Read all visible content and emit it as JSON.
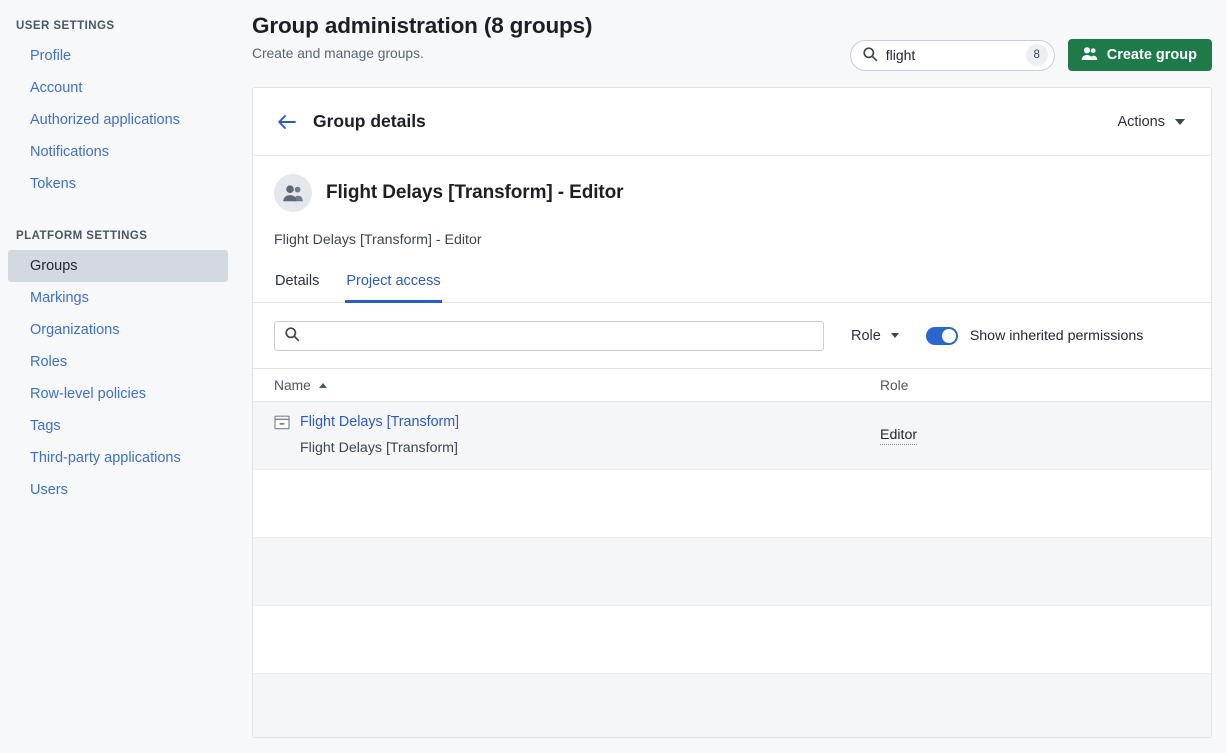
{
  "sidebar": {
    "sections": [
      {
        "title": "USER SETTINGS",
        "items": [
          {
            "label": "Profile",
            "name": "sidebar-item-profile",
            "active": false
          },
          {
            "label": "Account",
            "name": "sidebar-item-account",
            "active": false
          },
          {
            "label": "Authorized applications",
            "name": "sidebar-item-authorized-applications",
            "active": false
          },
          {
            "label": "Notifications",
            "name": "sidebar-item-notifications",
            "active": false
          },
          {
            "label": "Tokens",
            "name": "sidebar-item-tokens",
            "active": false
          }
        ]
      },
      {
        "title": "PLATFORM SETTINGS",
        "items": [
          {
            "label": "Groups",
            "name": "sidebar-item-groups",
            "active": true
          },
          {
            "label": "Markings",
            "name": "sidebar-item-markings",
            "active": false
          },
          {
            "label": "Organizations",
            "name": "sidebar-item-organizations",
            "active": false
          },
          {
            "label": "Roles",
            "name": "sidebar-item-roles",
            "active": false
          },
          {
            "label": "Row-level policies",
            "name": "sidebar-item-row-level-policies",
            "active": false
          },
          {
            "label": "Tags",
            "name": "sidebar-item-tags",
            "active": false
          },
          {
            "label": "Third-party applications",
            "name": "sidebar-item-third-party-applications",
            "active": false
          },
          {
            "label": "Users",
            "name": "sidebar-item-users",
            "active": false
          }
        ]
      }
    ]
  },
  "header": {
    "title": "Group administration (8 groups)",
    "subtitle": "Create and manage groups.",
    "search": {
      "value": "flight",
      "placeholder": "",
      "result_count": "8",
      "icon": "search-icon"
    },
    "create_button": {
      "label": "Create group",
      "icon": "group-add-icon",
      "color": "#1f7a4a"
    }
  },
  "card": {
    "back_icon": "arrow-left-icon",
    "title": "Group details",
    "actions": {
      "label": "Actions",
      "icon": "chevron-down-icon"
    },
    "group": {
      "avatar_icon": "group-avatar-icon",
      "name": "Flight Delays [Transform] - Editor",
      "description": "Flight Delays [Transform] - Editor"
    },
    "tabs": [
      {
        "label": "Details",
        "name": "tab-details",
        "active": false
      },
      {
        "label": "Project access",
        "name": "tab-project-access",
        "active": true
      }
    ],
    "filters": {
      "search": {
        "value": "",
        "placeholder": "",
        "icon": "search-icon"
      },
      "role_dropdown": {
        "label": "Role",
        "icon": "chevron-down-icon"
      },
      "inherited_toggle": {
        "label": "Show inherited permissions",
        "enabled": true,
        "color": "#2a66cf"
      }
    },
    "table": {
      "columns": [
        {
          "label": "Name",
          "name": "column-header-name",
          "sort": "asc",
          "sort_icon": "chevron-up-icon"
        },
        {
          "label": "Role",
          "name": "column-header-role",
          "sort": "none",
          "sort_icon": ""
        }
      ],
      "rows": [
        {
          "icon": "project-icon",
          "name": "Flight Delays [Transform]",
          "subtitle": "Flight Delays [Transform]",
          "role": "Editor"
        }
      ],
      "empty_row_count": 4
    }
  }
}
